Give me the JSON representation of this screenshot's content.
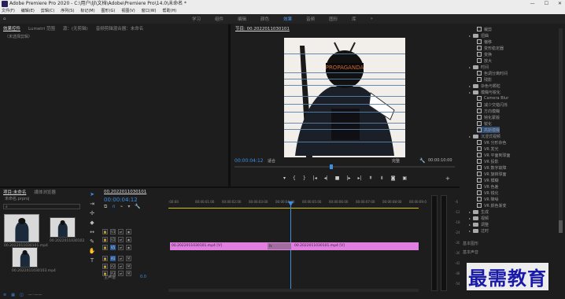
{
  "window": {
    "title": "Adobe Premiere Pro 2020 - C:\\用户\\ljl\\文档\\Adobe\\Premiere Pro\\14.0\\未命名 *"
  },
  "menu": [
    "文件(F)",
    "编辑(E)",
    "剪辑(C)",
    "序列(S)",
    "标记(M)",
    "图形(G)",
    "视图(V)",
    "窗口(W)",
    "帮助(H)"
  ],
  "workspace": {
    "tabs": [
      "学习",
      "组件",
      "编辑",
      "颜色",
      "效果",
      "音频",
      "图形",
      "库"
    ],
    "active_index": 4,
    "overflow": "»"
  },
  "left_panel": {
    "tabs": [
      "效果控件",
      "Lumetri 范围",
      "源：(无剪辑)",
      "音频剪辑混合器：未命名"
    ],
    "active_index": 0,
    "empty_text": "（未选择剪辑）"
  },
  "program_monitor": {
    "tab": "节目: 00.2022011030101",
    "timecode_left": "00:00:04:12",
    "fit": "适合",
    "quality": "完整",
    "timecode_right": "00:00:10:00",
    "helmet_text": "PROPAGANDA"
  },
  "project_panel": {
    "tabs": [
      "项目:未命名",
      "媒体浏览器"
    ],
    "file": "未命名.prproj",
    "search_placeholder": "",
    "items": [
      {
        "name": "00.2022011030101.mp4"
      },
      {
        "name": "00.2022011030102.mp4"
      },
      {
        "name": "00.2022011030103.mp4"
      }
    ]
  },
  "timeline": {
    "tab": "00.2022011030101",
    "timecode": "00:00:04:12",
    "ruler_labels": [
      ":00:00",
      "00:00:01:00",
      "00:00:02:00",
      "00:00:03:00",
      "00:00:04:00",
      "00:00:05:00",
      "00:00:06:00",
      "00:00:07:00",
      "00:00:08:00",
      "00:00:09:00"
    ],
    "tracks": [
      {
        "name": "V3"
      },
      {
        "name": "V2"
      },
      {
        "name": "V1"
      },
      {
        "name": "A1"
      },
      {
        "name": "A2"
      },
      {
        "name": "A3"
      }
    ],
    "clip_label": "00.2022011030101.mp4 [V]",
    "clip_label_2": "00.2022011030101.mp4 [V]",
    "mix_label": "主声道",
    "mix_value": "0.0"
  },
  "effects_panel": {
    "items": [
      {
        "kind": "fx",
        "label": "裁剪"
      },
      {
        "kind": "folder",
        "label": "扭曲"
      },
      {
        "kind": "fx",
        "label": "偏移"
      },
      {
        "kind": "fx",
        "label": "变形稳定器"
      },
      {
        "kind": "fx",
        "label": "变换"
      },
      {
        "kind": "fx",
        "label": "放大"
      },
      {
        "kind": "folder",
        "label": "时间"
      },
      {
        "kind": "fx",
        "label": "色调分离时间"
      },
      {
        "kind": "fx",
        "label": "残影"
      },
      {
        "kind": "folder",
        "label": "杂色与颗粒"
      },
      {
        "kind": "folder",
        "label": "模糊与锐化"
      },
      {
        "kind": "fx",
        "label": "Camera Blur"
      },
      {
        "kind": "fx",
        "label": "减少交错闪烁"
      },
      {
        "kind": "fx",
        "label": "方向模糊"
      },
      {
        "kind": "fx",
        "label": "钝化蒙版"
      },
      {
        "kind": "fx",
        "label": "锐化"
      },
      {
        "kind": "fx",
        "label": "高斯模糊"
      },
      {
        "kind": "folder",
        "label": "沉浸式视频"
      },
      {
        "kind": "fx",
        "label": "VR 分形杂色"
      },
      {
        "kind": "fx",
        "label": "VR 发光"
      },
      {
        "kind": "fx",
        "label": "VR 平面到球面"
      },
      {
        "kind": "fx",
        "label": "VR 投影"
      },
      {
        "kind": "fx",
        "label": "VR 数字故障"
      },
      {
        "kind": "fx",
        "label": "VR 旋转球面"
      },
      {
        "kind": "fx",
        "label": "VR 模糊"
      },
      {
        "kind": "fx",
        "label": "VR 色差"
      },
      {
        "kind": "fx",
        "label": "VR 锐化"
      },
      {
        "kind": "fx",
        "label": "VR 降噪"
      },
      {
        "kind": "fx",
        "label": "VR 颜色渐变"
      },
      {
        "kind": "folder",
        "label": "生成"
      },
      {
        "kind": "folder",
        "label": "视频"
      },
      {
        "kind": "folder",
        "label": "调整"
      },
      {
        "kind": "folder",
        "label": "过时"
      }
    ],
    "bottom_tabs": [
      "基本图形",
      "基本声音"
    ]
  },
  "watermark": {
    "text": "最需教育"
  },
  "colors": {
    "accent": "#3c8fe4",
    "clip": "#e07fe0",
    "playhead": "#3c8fe4"
  }
}
